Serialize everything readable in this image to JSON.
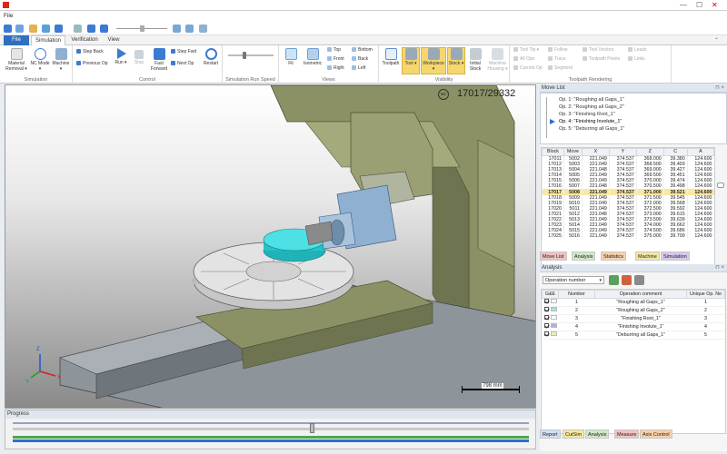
{
  "window": {
    "menu_label": "File",
    "min": "—",
    "max": "☐",
    "close": "✕"
  },
  "tabs": [
    {
      "label": "File",
      "kind": "file"
    },
    {
      "label": "Simulation",
      "kind": "active"
    },
    {
      "label": "Verification",
      "kind": ""
    },
    {
      "label": "View",
      "kind": ""
    }
  ],
  "ribbon": {
    "simulation_group": {
      "label": "Simulation",
      "material_removal": "Material Removal ▾",
      "nc_mode": "NC Mode ▾",
      "machine": "Machine ▾"
    },
    "control_group": {
      "label": "Control",
      "step_back": "Step Back",
      "previous_op": "Previous Op",
      "run": "Run ▾",
      "stop": "Stop",
      "fast_forward": "Fast Forward",
      "step_fwd": "Step Fwd",
      "next_op": "Next Op",
      "restart": "Restart"
    },
    "speed_group": {
      "label": "Simulation Run Speed",
      "speed_fraction": 0.35
    },
    "views_group": {
      "label": "Views",
      "fit": "Fit",
      "isometric": "Isometric",
      "top": "Top",
      "front": "Front",
      "right": "Right",
      "bottom": "Bottom",
      "back": "Back",
      "left": "Left"
    },
    "visibility_group": {
      "label": "Visibility",
      "toolpath": "Toolpath",
      "tool": "Tool ▾",
      "workpiece": "Workpiece ▾",
      "stock": "Stock ▾",
      "initial_stock": "Initial Stock",
      "machine_housing": "Machine Housing ▾"
    },
    "rendering_group": {
      "label": "Toolpath Rendering",
      "tool_tip": "Tool Tip ▾",
      "all_ops": "All Ops",
      "current_op": "Current Op",
      "follow": "Follow",
      "trace": "Trace",
      "segment": "Segment",
      "tool_vectors": "Tool Vectors",
      "toolpath_points": "Toolpath Points",
      "leads": "Leads",
      "links": "Links"
    }
  },
  "viewport": {
    "counter": "17017/29332",
    "badge": "NC",
    "scale_label": "798 mm",
    "colors": {
      "machine": "#8b9165",
      "table": "#d9d9d9",
      "stock": "#33d1d6",
      "head": "#8fb0d1"
    }
  },
  "progress": {
    "title": "Progress",
    "position_fraction": 0.58
  },
  "move_list": {
    "title": "Move List",
    "operations": [
      "Op. 1: \"Roughing all Gaps_1\"",
      "Op. 2: \"Roughing all Gaps_2\"",
      "Op. 3: \"Finishing Root_1\"",
      "Op. 4: \"Finishing Involute_1\"",
      "Op. 5: \"Deburring all Gaps_1\""
    ],
    "current_op_index": 3,
    "columns": [
      "Block",
      "Move",
      "X",
      "Y",
      "Z",
      "C",
      "A"
    ],
    "rows": [
      [
        "17011",
        "5002",
        "221.049",
        "374.537",
        "368.000",
        "39.380",
        "124.600"
      ],
      [
        "17012",
        "5003",
        "221.049",
        "374.537",
        "368.500",
        "39.403",
        "124.600"
      ],
      [
        "17013",
        "5004",
        "221.048",
        "374.537",
        "369.000",
        "39.427",
        "124.600"
      ],
      [
        "17014",
        "5005",
        "221.049",
        "374.537",
        "369.500",
        "39.451",
        "124.600"
      ],
      [
        "17015",
        "5006",
        "221.049",
        "374.537",
        "370.000",
        "39.474",
        "124.600"
      ],
      [
        "17016",
        "5007",
        "221.048",
        "374.537",
        "370.500",
        "39.498",
        "124.600"
      ],
      [
        "17017",
        "5008",
        "221.049",
        "374.537",
        "371.000",
        "39.521",
        "124.600"
      ],
      [
        "17018",
        "5009",
        "221.049",
        "374.537",
        "371.500",
        "39.545",
        "124.600"
      ],
      [
        "17019",
        "5010",
        "221.049",
        "374.537",
        "372.000",
        "39.568",
        "124.600"
      ],
      [
        "17020",
        "5011",
        "221.049",
        "374.537",
        "372.500",
        "39.592",
        "124.600"
      ],
      [
        "17021",
        "5012",
        "221.048",
        "374.537",
        "373.000",
        "39.615",
        "124.600"
      ],
      [
        "17022",
        "5013",
        "221.049",
        "374.537",
        "373.500",
        "39.639",
        "124.600"
      ],
      [
        "17023",
        "5014",
        "221.049",
        "374.537",
        "374.000",
        "39.662",
        "124.600"
      ],
      [
        "17024",
        "5015",
        "221.049",
        "374.537",
        "374.500",
        "39.686",
        "124.600"
      ],
      [
        "17025",
        "5016",
        "221.049",
        "374.537",
        "375.000",
        "39.709",
        "124.600"
      ]
    ],
    "current_row_index": 6,
    "tabs": [
      {
        "label": "Move List",
        "color": "#f3c1c1"
      },
      {
        "label": "Analysis",
        "color": "#cfe8c4"
      },
      {
        "label": "Statistics",
        "color": "#f7d0a8"
      },
      {
        "label": "Machine",
        "color": "#f3e6a0"
      },
      {
        "label": "Simulation",
        "color": "#d6c8ef"
      }
    ]
  },
  "analysis": {
    "title": "Analysis",
    "selector": "Operation number",
    "columns": [
      "G&E",
      "Number",
      "Operation comment",
      "Unique Op. No"
    ],
    "rows": [
      {
        "number": "1",
        "comment": "\"Roughing all Gaps_1\"",
        "unique": "1",
        "color": "#ffffff"
      },
      {
        "number": "2",
        "comment": "\"Roughing all Gaps_2\"",
        "unique": "2",
        "color": "#9fe3e6"
      },
      {
        "number": "3",
        "comment": "\"Finishing Root_1\"",
        "unique": "3",
        "color": "#ffffff"
      },
      {
        "number": "4",
        "comment": "\"Finishing Involute_1\"",
        "unique": "4",
        "color": "#b9a9e0"
      },
      {
        "number": "5",
        "comment": "\"Deburring all Gaps_1\"",
        "unique": "5",
        "color": "#eef2a8"
      }
    ],
    "tabs": [
      {
        "label": "Report",
        "color": "#cfe0f3"
      },
      {
        "label": "CutSim",
        "color": "#f3e6a0"
      },
      {
        "label": "Analysis",
        "color": "#cfe8c4"
      },
      {
        "label": "Measure",
        "color": "#f3c1c1"
      },
      {
        "label": "Axis Control",
        "color": "#f7d0a8"
      }
    ]
  }
}
